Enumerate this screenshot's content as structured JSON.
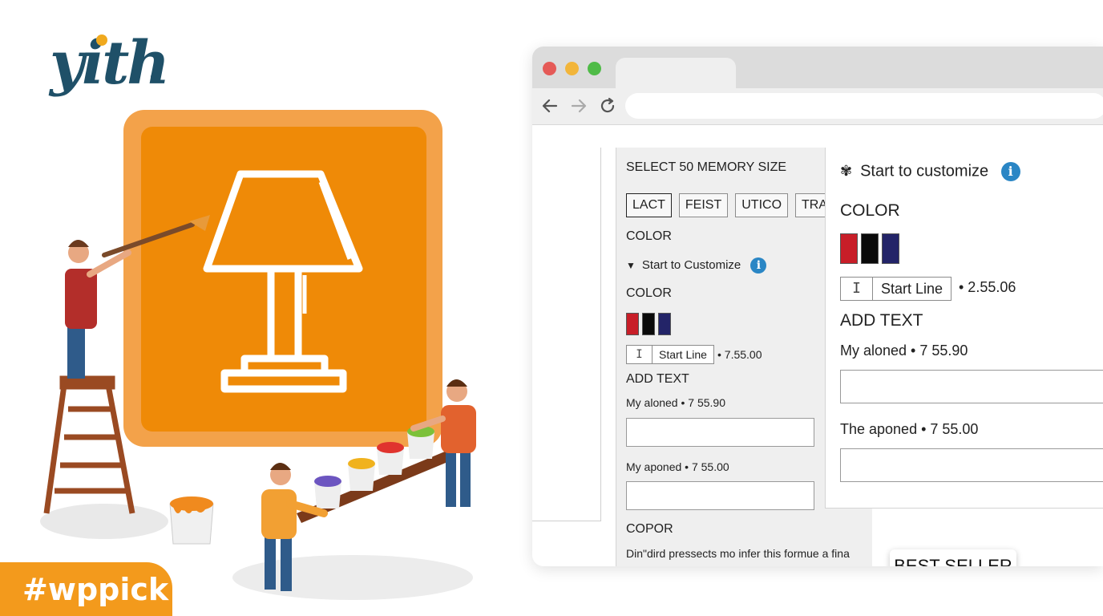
{
  "branding": {
    "logo_text": "yith",
    "hashtag": "#wppick",
    "colors": {
      "orange": "#ef8a07",
      "orange_light": "#f3a24a",
      "logo_teal": "#1f5068",
      "tag_orange": "#f39a1c"
    }
  },
  "illustration": {
    "icon": "lamp-icon",
    "figures": [
      "painter-on-ladder",
      "paint-pots-tray",
      "paint-bucket"
    ]
  },
  "browser": {
    "window_controls": [
      "close",
      "minimize",
      "maximize"
    ],
    "nav": {
      "back": "back-arrow-icon",
      "forward": "forward-arrow-icon",
      "reload": "reload-icon"
    },
    "address": ""
  },
  "left_panel": {
    "memory_title": "SELECT 50 MEMORY SIZE",
    "memory_options": [
      "LACT",
      "FEIST",
      "UTICO",
      "TRATM"
    ],
    "color_label_1": "COLOR",
    "customize_label": "Start to Customize",
    "color_label_2": "COLOR",
    "line_cursor": "I",
    "line_label": "Start Line",
    "line_price": "• 7.55.00",
    "add_text_title": "ADD TEXT",
    "field1_label": "My aloned • 7 55.90",
    "field2_label": "My aponed • 7 55.00",
    "copor_title": "COPOR",
    "footer_text": "Din\"dird pressects mo infer this formue a fina"
  },
  "right_panel": {
    "customize_title": "Start to customize",
    "color_label": "COLOR",
    "line_cursor": "I",
    "line_label": "Start Line",
    "line_price": "• 2.55.06",
    "add_text_title": "ADD TEXT",
    "field1_label": "My aloned • 7 55.90",
    "field2_label": "The aponed • 7 55.00",
    "best_seller": "BEST SELLER"
  },
  "swatch_colors": [
    "#c81e28",
    "#0a0a0a",
    "#232468"
  ]
}
